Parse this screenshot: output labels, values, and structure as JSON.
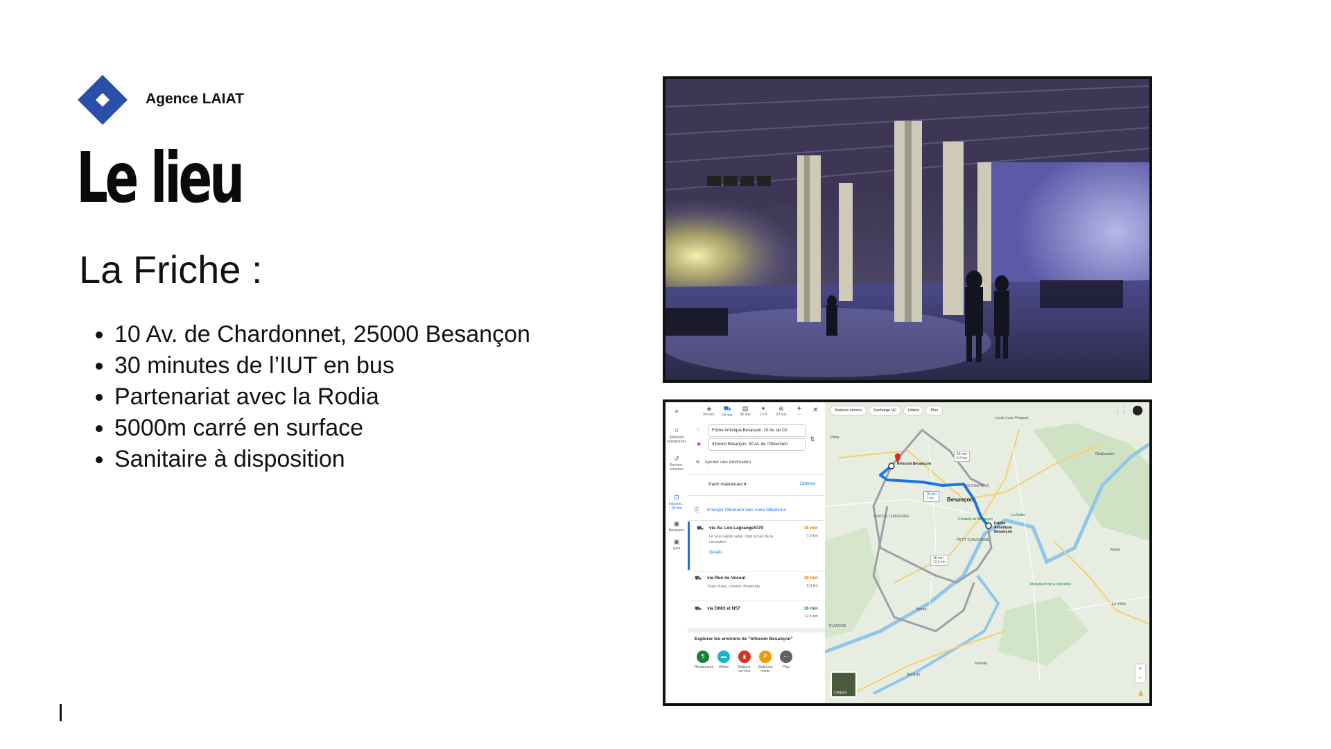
{
  "agency": {
    "name": "Agence LAIAT"
  },
  "slide": {
    "title": "Le lieu",
    "subtitle": "La Friche :",
    "bullets": [
      "10 Av. de Chardonnet, 25000 Besançon",
      "30 minutes de l’IUT en bus",
      "Partenariat avec la Rodia",
      "5000m carré en surface",
      "Sanitaire à disposition"
    ]
  },
  "colors": {
    "logo": "#2a4fa8",
    "map_route": "#1a73e8",
    "map_alt_route": "#9aa0a6"
  },
  "maps": {
    "rail": [
      {
        "icon": "bookmark-icon",
        "label": "Adresses enregistrées"
      },
      {
        "icon": "history-icon",
        "label": "Recherc. récentes"
      },
      {
        "icon": "car-icon",
        "label": "Infocom… 18 min"
      },
      {
        "icon": "photo-icon",
        "label": "Besançon"
      },
      {
        "icon": "photo-icon",
        "label": "Lyon"
      }
    ],
    "modes": [
      {
        "icon": "directions-icon",
        "label": "Recom."
      },
      {
        "icon": "car-icon",
        "label": "18 min"
      },
      {
        "icon": "bus-icon",
        "label": "36 min"
      },
      {
        "icon": "walk-icon",
        "label": "1 h 6"
      },
      {
        "icon": "bike-icon",
        "label": "23 min"
      },
      {
        "icon": "flight-icon",
        "label": "—"
      }
    ],
    "origin": "Friche Artistique Besançon, 10 Av. de Ch",
    "destination": "Infocom Besançon, 30 Av. de l'Observato",
    "add_destination": "Ajouter une destination",
    "leave_now": "Partir maintenant ▾",
    "options": "Options",
    "send_to_phone": "Envoyer l'itinéraire vers votre téléphone",
    "routes": [
      {
        "name": "via Av. Léo Lagrange/D70",
        "desc": "Le plus rapide selon l'état actuel de la circulation",
        "time": "18 min",
        "time_color": "#e37400",
        "distance": "7,0 km",
        "details": "Détails"
      },
      {
        "name": "via Rue de Vesoul",
        "desc": "Trafic fluide, comme d'habitude",
        "time": "18 min",
        "time_color": "#e37400",
        "distance": "8,3 km"
      },
      {
        "name": "via D683 et N57",
        "desc": "",
        "time": "18 min",
        "time_color": "#188038",
        "distance": "12,5 km"
      }
    ],
    "explore_title": "Explorer les environs de \"Infocom Besançon\"",
    "categories": [
      {
        "label": "Restaurants",
        "color": "#188038",
        "glyph": "¶"
      },
      {
        "label": "Hôtels",
        "color": "#12b5cb",
        "glyph": "▬"
      },
      {
        "label": "Stations-ser vice",
        "color": "#d93025",
        "glyph": "▮"
      },
      {
        "label": "Stationne ments",
        "color": "#f29900",
        "glyph": "P"
      },
      {
        "label": "Plus",
        "color": "#5f6368",
        "glyph": "···"
      }
    ],
    "chips": [
      "Stations-service",
      "Recharge VE",
      "Hôtels",
      "Plus"
    ],
    "layers_label": "Calques",
    "map_labels": {
      "besancon": "Besançon",
      "infocom": "Infocom Besançon",
      "friche": "Friche Artistique Besançon",
      "route_time": "18 min",
      "route_dist": "7 km",
      "alt1_time": "18 min",
      "alt1_dist": "8,3 km",
      "alt2_time": "18 min",
      "alt2_dist": "12,5 km",
      "la_rodia": "La Rodia",
      "chalezeule": "Chalezeule",
      "les_chaprais": "LES CHAPRAIS",
      "pirey": "Pirey",
      "fontain": "Fontain",
      "arguel": "ARGUEL",
      "beure": "Beure",
      "morre": "Morre",
      "la_vieze": "La Vèze",
      "citadelle": "Citadelle de Besançon",
      "planoise": "PLANOISE",
      "tempering": "STATICE TEMPERING",
      "chaudanne": "PETIT CHAUDANNE",
      "monument": "Monument de la Libération",
      "lycee": "Lycée Louis Pergaud"
    }
  }
}
